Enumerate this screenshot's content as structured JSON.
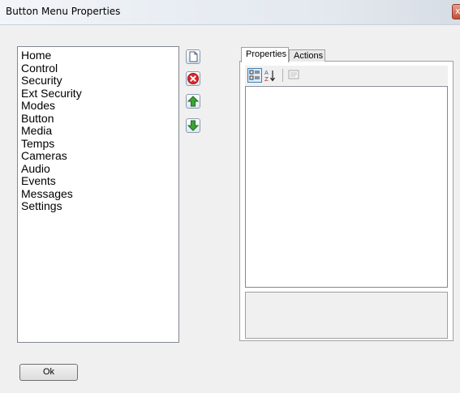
{
  "window": {
    "title": "Button Menu Properties",
    "close_label": "x"
  },
  "menu_list": {
    "items": [
      "Home",
      "Control",
      "Security",
      "Ext Security",
      "Modes",
      "Button",
      "Media",
      "Temps",
      "Cameras",
      "Audio",
      "Events",
      "Messages",
      "Settings"
    ]
  },
  "side_buttons": [
    {
      "name": "new",
      "icon": "new-document-icon"
    },
    {
      "name": "delete",
      "icon": "delete-icon"
    },
    {
      "name": "move-up",
      "icon": "arrow-up-icon"
    },
    {
      "name": "move-down",
      "icon": "arrow-down-icon"
    }
  ],
  "tabs": [
    {
      "label": "Properties",
      "active": true
    },
    {
      "label": "Actions",
      "active": false
    }
  ],
  "toolbar": {
    "buttons": [
      "categorized-icon",
      "alphabetical-sort-icon",
      "property-pages-icon"
    ]
  },
  "footer": {
    "ok_label": "Ok"
  },
  "colors": {
    "delete_red": "#e0262b",
    "arrow_green": "#3da33a",
    "title_gradient_end": "#d7dde4"
  }
}
